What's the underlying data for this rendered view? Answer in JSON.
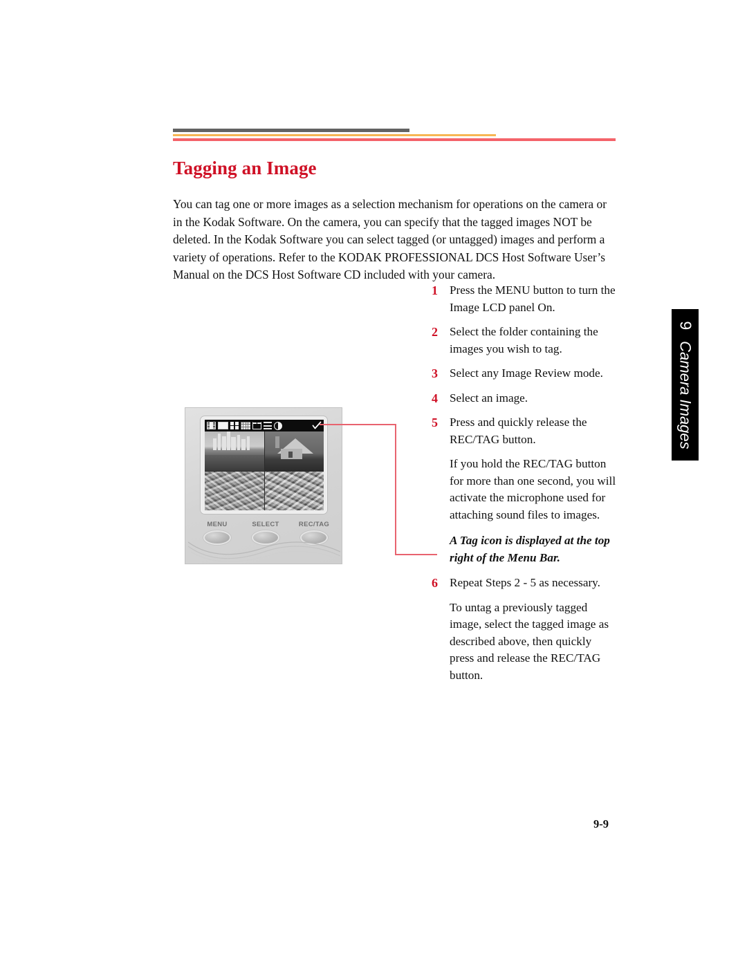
{
  "page": {
    "number": "9-9",
    "heading": "Tagging an Image",
    "intro": "You can tag one or more images as a selection mechanism for operations on the camera or in the Kodak Software. On the camera, you can specify that the tagged images NOT be deleted. In the Kodak Software you can select tagged (or untagged) images and perform a variety of operations. Refer to the KODAK PROFESSIONAL DCS Host Software User’s Manual on the DCS Host Software CD included with your camera."
  },
  "colors": {
    "heading": "#cf1126",
    "step_number": "#cf1126",
    "rule_dark": "#636363",
    "rule_tan": "#f7b653",
    "rule_red": "#f4636a",
    "callout": "#e8636f",
    "tab_background": "#000000",
    "tab_text": "#ffffff"
  },
  "side_tab": {
    "chapter": "9",
    "title": "Camera Images"
  },
  "steps": [
    {
      "num": "1",
      "text": "Press the MENU button to turn the Image LCD panel On."
    },
    {
      "num": "2",
      "text": "Select the folder containing the images you wish to tag."
    },
    {
      "num": "3",
      "text": "Select any Image Review mode."
    },
    {
      "num": "4",
      "text": "Select an image."
    },
    {
      "num": "5",
      "text": "Press and quickly release the REC/TAG button."
    }
  ],
  "step5_note": "If you hold the REC/TAG button for more than one second, you will activate the microphone used for attaching sound files to images.",
  "tag_italic_note": "A Tag icon is displayed at the top right of the Menu Bar.",
  "step6": {
    "num": "6",
    "text": "Repeat Steps 2 - 5 as necessary."
  },
  "step6_note": "To untag a previously tagged image, select the tagged image as described above, then quickly press and release the REC/TAG button.",
  "camera": {
    "menu_icons": [
      "film-strip-icon",
      "single-image-icon",
      "four-up-grid-icon",
      "nine-up-grid-icon",
      "folder-icon",
      "lines-icon",
      "contrast-icon"
    ],
    "tag_icon": "tag-checkmark-icon",
    "thumbnails": [
      {
        "name": "city-skyline-thumbnail",
        "selected": true
      },
      {
        "name": "house-thumbnail",
        "selected": false
      },
      {
        "name": "crowd-thumbnail-left",
        "selected": false
      },
      {
        "name": "crowd-thumbnail-right",
        "selected": false
      }
    ],
    "buttons": [
      {
        "label": "MENU"
      },
      {
        "label": "SELECT"
      },
      {
        "label": "REC/TAG"
      }
    ]
  }
}
